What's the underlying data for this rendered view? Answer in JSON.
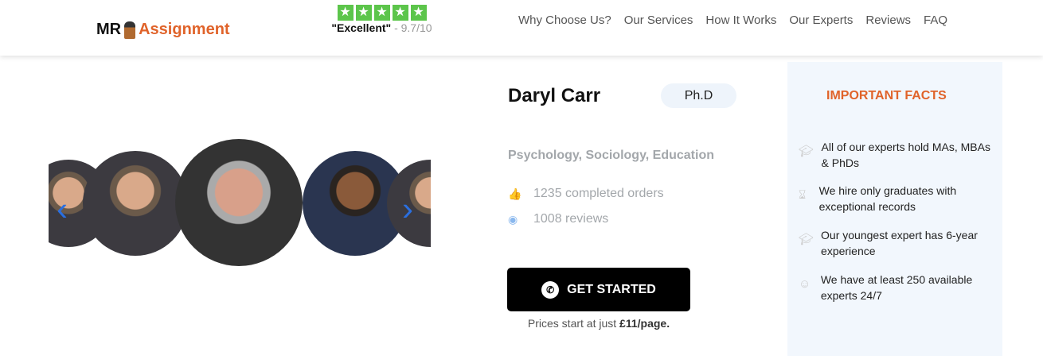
{
  "header": {
    "logo_left": "MR",
    "logo_right": "Assignment",
    "rating_label": "\"Excellent\"",
    "rating_score": " - 9.7/10",
    "stars": 5,
    "nav": [
      "Why Choose Us?",
      "Our Services",
      "How It Works",
      "Our Experts",
      "Reviews",
      "FAQ"
    ]
  },
  "expert": {
    "name": "Daryl Carr",
    "degree": "Ph.D",
    "subjects": "Psychology, Sociology, Education",
    "orders": "1235 completed orders",
    "reviews": "1008 reviews"
  },
  "cta": {
    "label": "GET STARTED",
    "price_prefix": "Prices start at just ",
    "price_value": "£11/page."
  },
  "facts": {
    "title": "IMPORTANT FACTS",
    "items": [
      {
        "icon": "graduation-cap-icon",
        "text": "All of our experts hold MAs, MBAs & PhDs"
      },
      {
        "icon": "hourglass-icon",
        "text": "We hire only graduates with exceptional records"
      },
      {
        "icon": "graduation-cap-icon",
        "text": "Our youngest expert has 6-year experience"
      },
      {
        "icon": "smile-icon",
        "text": "We have at least 250 available experts 24/7"
      }
    ]
  },
  "colors": {
    "accent": "#e0632a",
    "star": "#5cc54b",
    "arrow": "#2a6fe0",
    "panel": "#f2f7fd"
  }
}
